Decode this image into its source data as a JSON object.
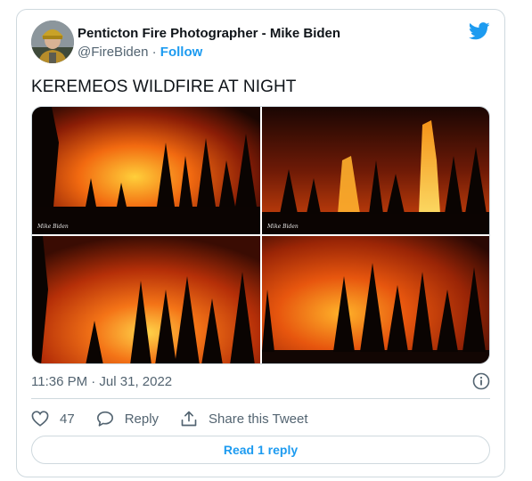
{
  "author": {
    "name": "Penticton Fire Photographer - Mike Biden",
    "handle": "@FireBiden",
    "separator": " · ",
    "follow_label": "Follow"
  },
  "brand_icon": "twitter-bird-icon",
  "tweet_text": "KEREMEOS WILDFIRE AT NIGHT",
  "media": {
    "photos": [
      {
        "name": "wildfire-photo-1"
      },
      {
        "name": "wildfire-photo-2"
      },
      {
        "name": "wildfire-photo-3"
      },
      {
        "name": "wildfire-photo-4"
      }
    ]
  },
  "timestamp": "11:36 PM · Jul 31, 2022",
  "actions": {
    "like_count": "47",
    "reply_label": "Reply",
    "share_label": "Share this Tweet"
  },
  "read_replies_label": "Read 1 reply",
  "colors": {
    "accent": "#1d9bf0",
    "text": "#0f1419",
    "secondary_text": "#536471",
    "border": "#cfd9de"
  }
}
